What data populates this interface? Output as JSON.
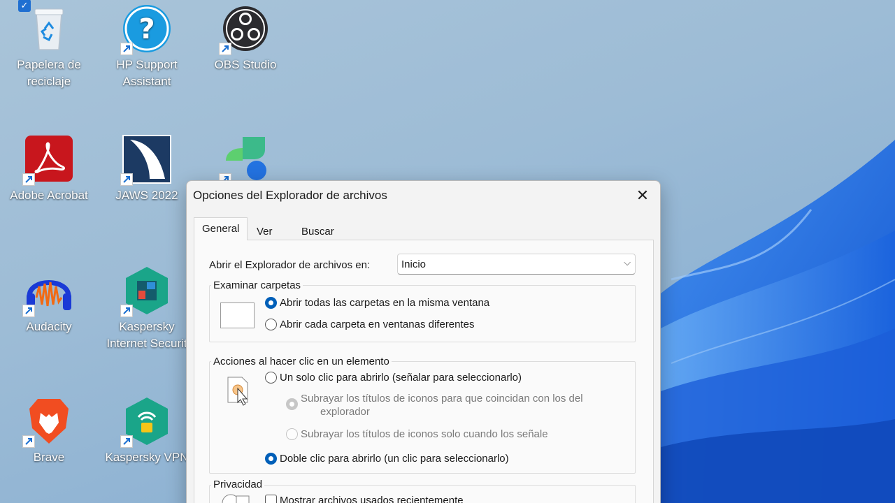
{
  "desktop": {
    "icons": [
      {
        "label_line1": "Papelera de",
        "label_line2": "reciclaje",
        "icon": "recycle-bin-icon",
        "selected": true
      },
      {
        "label_line1": "HP Support",
        "label_line2": "Assistant",
        "icon": "hp-support-icon"
      },
      {
        "label_line1": "OBS Studio",
        "icon": "obs-studio-icon"
      },
      {
        "label_line1": "Adobe Acrobat",
        "icon": "adobe-acrobat-icon"
      },
      {
        "label_line1": "JAWS 2022",
        "icon": "jaws-icon"
      },
      {
        "label_line1": "",
        "icon": "app-icon"
      },
      {
        "label_line1": "Audacity",
        "icon": "audacity-icon"
      },
      {
        "label_line1": "Kaspersky",
        "label_line2": "Internet Securit",
        "icon": "kaspersky-internet-security-icon"
      },
      {
        "label_line1": "Brave",
        "icon": "brave-icon"
      },
      {
        "label_line1": "Kaspersky VPN",
        "icon": "kaspersky-vpn-icon"
      }
    ]
  },
  "dialog": {
    "title": "Opciones del Explorador de archivos",
    "close_glyph": "✕",
    "tabs": [
      {
        "label": "General",
        "active": true
      },
      {
        "label": "Ver"
      },
      {
        "label": "Buscar"
      }
    ],
    "open_in_label": "Abrir el Explorador de archivos en:",
    "open_in_value": "Inicio",
    "browse_group": {
      "title": "Examinar carpetas",
      "options": [
        {
          "label": "Abrir todas las carpetas en la misma ventana",
          "selected": true
        },
        {
          "label": "Abrir cada carpeta en ventanas diferentes",
          "selected": false
        }
      ]
    },
    "click_group": {
      "title": "Acciones al hacer clic en un elemento",
      "single_click": "Un solo clic para abrirlo (señalar para seleccionarlo)",
      "underline_always_line1": "Subrayar los títulos de iconos para que coincidan con los del",
      "underline_always_line2": "explorador",
      "underline_hover": "Subrayar los títulos de iconos solo cuando los señale",
      "double_click": "Doble clic para abrirlo (un clic para seleccionarlo)"
    },
    "privacy_group": {
      "title": "Privacidad",
      "show_recent": "Mostrar archivos usados recientemente"
    }
  },
  "colors": {
    "accent": "#005fb8",
    "dialog_bg": "#f3f3f3",
    "panel_bg": "#fafafa"
  }
}
